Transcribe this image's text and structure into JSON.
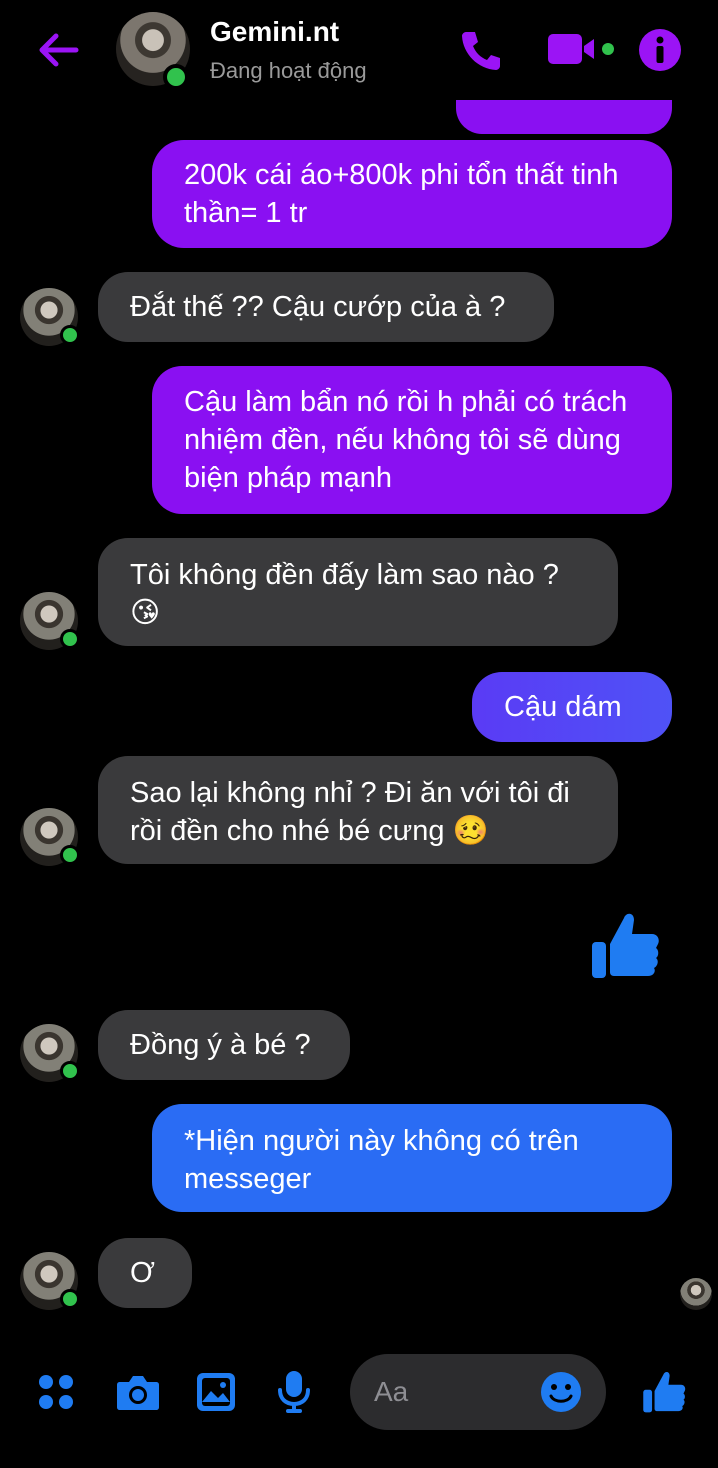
{
  "header": {
    "contact_name": "Gemini.nt",
    "status": "Đang hoạt động",
    "back_icon": "back-arrow-icon",
    "call_icon": "phone-icon",
    "video_icon": "video-camera-icon",
    "info_icon": "info-icon",
    "accent_color": "#9b14f5"
  },
  "messages": [
    {
      "from": "me",
      "text": "200k cái áo+800k phi tổn thất tinh thần= 1 tr"
    },
    {
      "from": "contact",
      "text": "Đắt thế ?? Cậu cướp của à ?"
    },
    {
      "from": "me",
      "text": "Cậu làm bẩn nó rồi h phải có trách nhiệm đền, nếu không tôi sẽ dùng biện pháp mạnh"
    },
    {
      "from": "contact",
      "text": "Tôi không đền đấy làm sao nào ? 😘"
    },
    {
      "from": "me",
      "text": "Cậu dám"
    },
    {
      "from": "contact",
      "text": "Sao lại không nhỉ ? Đi ăn với tôi đi rồi đền cho nhé bé cưng 🥴"
    },
    {
      "from": "me",
      "type": "thumbs-up",
      "icon": "thumbs-up-icon"
    },
    {
      "from": "contact",
      "text": "Đồng ý à bé ?"
    },
    {
      "from": "me",
      "text": "*Hiện người này không có trên messeger"
    },
    {
      "from": "contact",
      "text": "Ơ"
    }
  ],
  "composer": {
    "placeholder": "Aa",
    "tools": [
      "menu-icon",
      "camera-icon",
      "gallery-icon",
      "microphone-icon"
    ],
    "emoji_icon": "emoji-icon",
    "like_icon": "thumbs-up-icon",
    "tool_color": "#1f7cf2"
  }
}
